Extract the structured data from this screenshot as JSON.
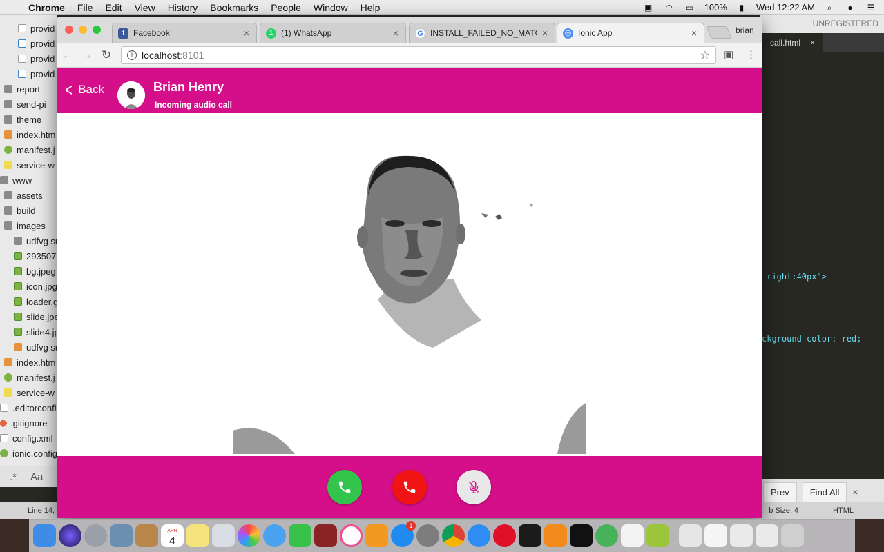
{
  "menubar": {
    "app_name": "Chrome",
    "items": [
      "File",
      "Edit",
      "View",
      "History",
      "Bookmarks",
      "People",
      "Window",
      "Help"
    ],
    "battery": "100%",
    "clock": "Wed 12:22 AM"
  },
  "editor": {
    "unregistered": "UNREGISTERED",
    "tab_label": "call.html",
    "code_line_1": "-right:40px\">",
    "code_line_2": "ckground-color: red;",
    "find_prev": "Prev",
    "find_all": "Find All",
    "status_line": "Line 14,",
    "status_tab": "b Size: 4",
    "status_syntax": "HTML",
    "sidebar_toolbar_regex": ".*",
    "sidebar_toolbar_case": "Aa"
  },
  "sidebar": {
    "items": [
      {
        "label": "provid",
        "icon": "file",
        "indent": 26
      },
      {
        "label": "provid",
        "icon": "ts",
        "indent": 26
      },
      {
        "label": "provid",
        "icon": "file",
        "indent": 26
      },
      {
        "label": "provid",
        "icon": "ts",
        "indent": 26
      },
      {
        "label": "report",
        "icon": "folder",
        "indent": 6
      },
      {
        "label": "send-pi",
        "icon": "folder",
        "indent": 6
      },
      {
        "label": "theme",
        "icon": "folder",
        "indent": 6
      },
      {
        "label": "index.htm",
        "icon": "html",
        "indent": 6
      },
      {
        "label": "manifest.j",
        "icon": "json",
        "indent": 6
      },
      {
        "label": "service-w",
        "icon": "js",
        "indent": 6
      },
      {
        "label": "www",
        "icon": "folder",
        "indent": 0
      },
      {
        "label": "assets",
        "icon": "folder",
        "indent": 6
      },
      {
        "label": "build",
        "icon": "folder",
        "indent": 6
      },
      {
        "label": "images",
        "icon": "folder",
        "indent": 6
      },
      {
        "label": "udfvg su",
        "icon": "folder",
        "indent": 20
      },
      {
        "label": "293507",
        "icon": "img",
        "indent": 20
      },
      {
        "label": "bg.jpeg",
        "icon": "img",
        "indent": 20
      },
      {
        "label": "icon.jpg",
        "icon": "img",
        "indent": 20
      },
      {
        "label": "loader.g",
        "icon": "img",
        "indent": 20
      },
      {
        "label": "slide.jpe",
        "icon": "img",
        "indent": 20
      },
      {
        "label": "slide4.jp",
        "icon": "img",
        "indent": 20
      },
      {
        "label": "udfvg su",
        "icon": "html",
        "indent": 20
      },
      {
        "label": "index.htm",
        "icon": "html",
        "indent": 6
      },
      {
        "label": "manifest.j",
        "icon": "json",
        "indent": 6
      },
      {
        "label": "service-w",
        "icon": "js",
        "indent": 6
      },
      {
        "label": ".editorconfi",
        "icon": "file",
        "indent": 0
      },
      {
        "label": ".gitignore",
        "icon": "git",
        "indent": 0
      },
      {
        "label": "config.xml",
        "icon": "file",
        "indent": 0
      },
      {
        "label": "ionic.config",
        "icon": "json",
        "indent": 0
      }
    ]
  },
  "browser": {
    "tabs": [
      {
        "title": "Facebook",
        "favicon": "facebook-icon",
        "color": "#3b5998",
        "glyph": "f"
      },
      {
        "title": "(1) WhatsApp",
        "favicon": "whatsapp-icon",
        "color": "#25d366",
        "glyph": "1"
      },
      {
        "title": "INSTALL_FAILED_NO_MATCH",
        "favicon": "google-icon",
        "color": "#ffffff",
        "glyph": "G"
      },
      {
        "title": "Ionic App",
        "favicon": "ionic-icon",
        "color": "#4e8ef7",
        "glyph": "◎"
      }
    ],
    "profile_name": "brian",
    "url_host": "localhost",
    "url_port": ":8101"
  },
  "app": {
    "back_label": "Back",
    "caller_name": "Brian Henry",
    "call_status": "Incoming audio call",
    "colors": {
      "primary": "#d50f89",
      "answer": "#32c44b",
      "decline": "#f11414",
      "mute": "#e8e8e8"
    }
  },
  "dock": {
    "calendar_month": "APR",
    "calendar_day": "4",
    "appstore_badge": "1"
  }
}
